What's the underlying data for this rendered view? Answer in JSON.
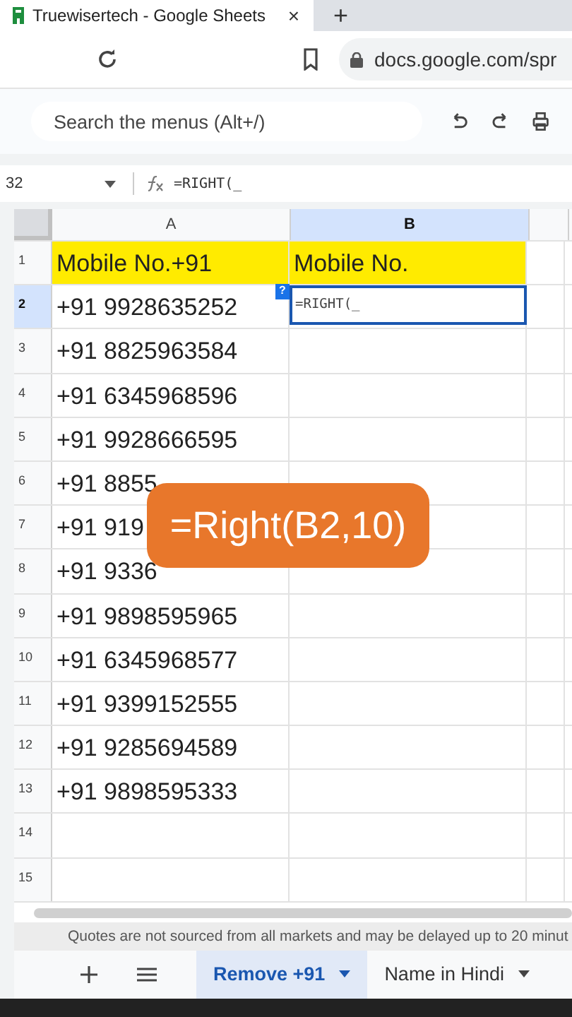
{
  "browser": {
    "tab_title": "Truewisertech - Google Sheets",
    "close": "×",
    "new_tab": "+",
    "url": "docs.google.com/spr"
  },
  "toolbar": {
    "search": {
      "placeholder": "Search the menus (Alt+/)"
    }
  },
  "formula_bar": {
    "cell_ref": "32",
    "formula": "=RIGHT(_"
  },
  "sheet": {
    "columns": [
      {
        "label": "A",
        "selected": false
      },
      {
        "label": "B",
        "selected": true
      }
    ],
    "rows": [
      {
        "number": "1",
        "selected": false,
        "cells": [
          "Mobile No.+91",
          "Mobile No."
        ],
        "highlight": true
      },
      {
        "number": "2",
        "selected": true,
        "cells": [
          "+91 9928635252",
          ""
        ],
        "highlight": false,
        "editor": {
          "text": "=RIGHT(_",
          "help": "?"
        }
      },
      {
        "number": "3",
        "selected": false,
        "cells": [
          "+91 8825963584",
          ""
        ],
        "highlight": false
      },
      {
        "number": "4",
        "selected": false,
        "cells": [
          "+91 6345968596",
          ""
        ],
        "highlight": false
      },
      {
        "number": "5",
        "selected": false,
        "cells": [
          "+91 9928666595",
          ""
        ],
        "highlight": false
      },
      {
        "number": "6",
        "selected": false,
        "cells": [
          "+91 8855",
          ""
        ],
        "highlight": false
      },
      {
        "number": "7",
        "selected": false,
        "cells": [
          "+91 919",
          ""
        ],
        "highlight": false
      },
      {
        "number": "8",
        "selected": false,
        "cells": [
          "+91 9336",
          ""
        ],
        "highlight": false
      },
      {
        "number": "9",
        "selected": false,
        "cells": [
          "+91 9898595965",
          ""
        ],
        "highlight": false
      },
      {
        "number": "10",
        "selected": false,
        "cells": [
          "+91 6345968577",
          ""
        ],
        "highlight": false
      },
      {
        "number": "11",
        "selected": false,
        "cells": [
          "+91 9399152555",
          ""
        ],
        "highlight": false
      },
      {
        "number": "12",
        "selected": false,
        "cells": [
          "+91 9285694589",
          ""
        ],
        "highlight": false
      },
      {
        "number": "13",
        "selected": false,
        "cells": [
          "+91 9898595333",
          ""
        ],
        "highlight": false
      },
      {
        "number": "14",
        "selected": false,
        "cells": [
          "",
          ""
        ],
        "highlight": false
      },
      {
        "number": "15",
        "selected": false,
        "cells": [
          "",
          ""
        ],
        "highlight": false
      }
    ]
  },
  "notice": "Quotes are not sourced from all markets and may be delayed up to 20 minut",
  "sheet_tabs": [
    {
      "label": "Remove +91",
      "selected": true
    },
    {
      "label": "Name in Hindi",
      "selected": false
    }
  ],
  "caption": "=Right(B2,10)"
}
